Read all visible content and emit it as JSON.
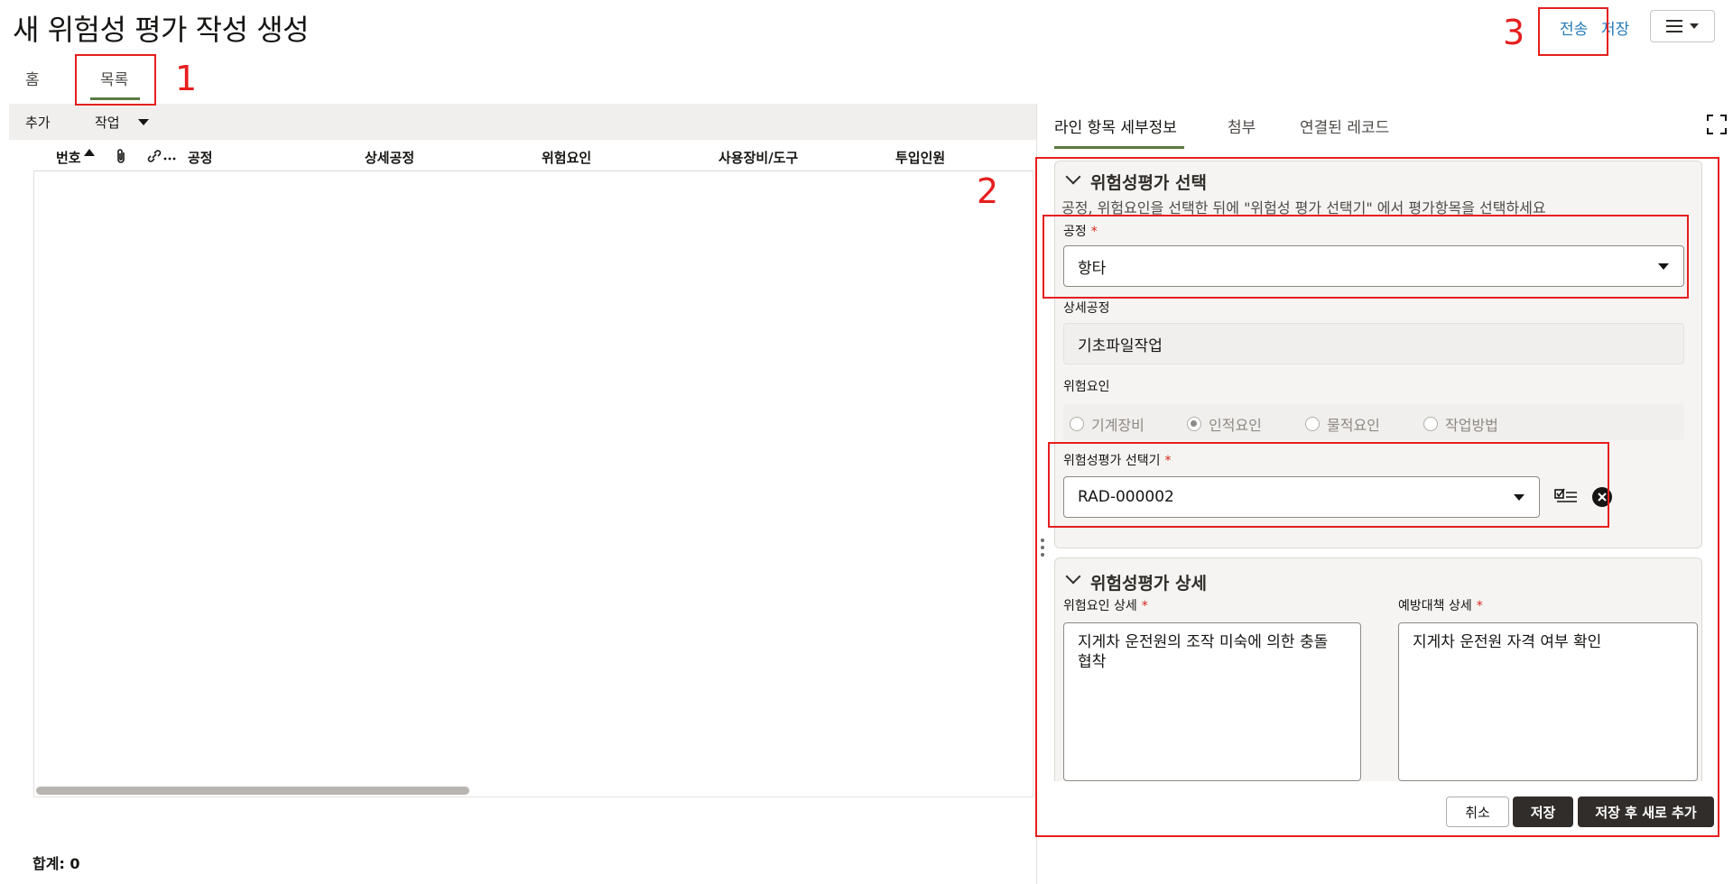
{
  "header": {
    "title": "새 위험성 평가 작성 생성",
    "send_label": "전송",
    "save_label": "저장"
  },
  "tabs": [
    {
      "label": "홈"
    },
    {
      "label": "목록"
    }
  ],
  "toolbar": {
    "add_label": "추가",
    "action_label": "작업"
  },
  "grid": {
    "columns": [
      "번호",
      "공정",
      "상세공정",
      "위험요인",
      "사용장비/도구",
      "투입인원"
    ],
    "total_label": "합계: 0"
  },
  "detail_tabs": [
    {
      "label": "라인 항목 세부정보"
    },
    {
      "label": "첨부"
    },
    {
      "label": "연결된 레코드"
    }
  ],
  "section_select": {
    "title": "위험성평가 선택",
    "hint": "공정, 위험요인을 선택한 뒤에 \"위험성 평가 선택기\" 에서 평가항목을 선택하세요",
    "process_label": "공정",
    "process_value": "항타",
    "subprocess_label": "상세공정",
    "subprocess_value": "기초파일작업",
    "risk_label": "위험요인",
    "risk_options": [
      "기계장비",
      "인적요인",
      "물적요인",
      "작업방법"
    ],
    "risk_selected": "인적요인",
    "selector_label": "위험성평가 선택기",
    "selector_value": "RAD-000002"
  },
  "section_detail": {
    "title": "위험성평가 상세",
    "risk_detail_label": "위험요인 상세",
    "risk_detail_value": "지게차 운전원의 조작 미숙에 의한 충돌 협착",
    "prevention_label": "예방대책 상세",
    "prevention_value": "지게차 운전원 자격 여부 확인"
  },
  "footer": {
    "cancel_label": "취소",
    "save_label": "저장",
    "save_new_label": "저장 후 새로 추가"
  },
  "annotations": [
    "1",
    "2",
    "3"
  ],
  "colors": {
    "annotation": "#e61e1e",
    "link": "#227ab8",
    "tab_active": "#5a7a42",
    "button_dark": "#312d2a"
  }
}
